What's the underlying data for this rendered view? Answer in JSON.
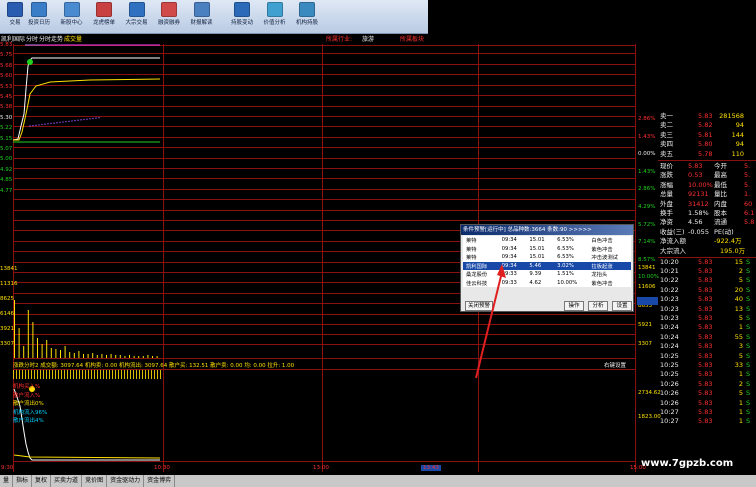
{
  "toolbar": [
    {
      "label": "交易",
      "color": "#2a5db0"
    },
    {
      "label": "投资日历",
      "color": "#3a7ec8"
    },
    {
      "label": "新股中心",
      "color": "#4a8ad0"
    },
    {
      "label": "龙虎榜单",
      "color": "#c84040"
    },
    {
      "label": "大宗交易",
      "color": "#3070c0"
    },
    {
      "label": "融资融券",
      "color": "#d04a4a"
    },
    {
      "label": "财报解读",
      "color": "#4a80c0"
    },
    {
      "label": "持股变动",
      "color": "#2a6ab8"
    },
    {
      "label": "价值分析",
      "color": "#40a0d0"
    },
    {
      "label": "机构持股",
      "color": "#3a8ac0"
    }
  ],
  "tabs": {
    "t1": "分时",
    "t2": "分时走势",
    "t3": "成交量"
  },
  "stock": {
    "name": "凯利国际"
  },
  "info": {
    "industry_label": "所属行业:",
    "industry_value": "旅游",
    "concept_label": "所属板块"
  },
  "price_axis": [
    "5.83",
    "5.75",
    "5.68",
    "5.60",
    "5.53",
    "5.45",
    "5.38",
    "5.30",
    "5.22",
    "5.15",
    "5.07",
    "5.00",
    "4.92",
    "4.85",
    "4.77"
  ],
  "pct_axis": [
    "2.86%",
    "1.43%",
    "0.00%",
    "1.43%",
    "2.86%",
    "4.29%",
    "5.72%",
    "7.14%",
    "8.57%",
    "10.00%"
  ],
  "vol_axis_left": [
    "13841",
    "11316",
    "8625",
    "6146",
    "3921",
    "3307"
  ],
  "vol_axis_right": [
    "13841",
    "11606",
    "8653",
    "5921",
    "3307"
  ],
  "fund_axis": [
    "2734.62",
    "1823.00"
  ],
  "volume_stats": "涨跌分时2  成交额: 3097.64  机构卖: 0.00  机构流出: 3097.64  散户买: 132.51  散户卖: 0.00  均: 0.00  拉升: 1.00",
  "setting_label": "右键设置",
  "ind_legend": [
    "机构买入%",
    "散户流入%",
    "散户流出0%",
    "机构流入96%",
    "散户流出4%"
  ],
  "time_axis": [
    "9:30",
    "10:30",
    "13:00",
    "13:43",
    "15:00"
  ],
  "quote_book": [
    {
      "label": "卖一",
      "price": "5.83",
      "vol": "281568"
    },
    {
      "label": "卖二",
      "price": "5.82",
      "vol": "94"
    },
    {
      "label": "卖三",
      "price": "5.81",
      "vol": "144"
    },
    {
      "label": "卖四",
      "price": "5.80",
      "vol": "94"
    },
    {
      "label": "卖五",
      "price": "5.78",
      "vol": "110"
    }
  ],
  "quote_stats": [
    {
      "l1": "现价",
      "v1": "5.83",
      "l2": "今开",
      "v2": "5."
    },
    {
      "l1": "涨跌",
      "v1": "0.53",
      "l2": "最高",
      "v2": "5."
    },
    {
      "l1": "涨幅",
      "v1": "10.00%",
      "l2": "最低",
      "v2": "5."
    },
    {
      "l1": "总量",
      "v1": "92131",
      "l2": "量比",
      "v2": "1."
    },
    {
      "l1": "外盘",
      "v1": "31412",
      "l2": "内盘",
      "v2": "60"
    },
    {
      "l1": "换手",
      "v1": "1.58%",
      "l2": "股本",
      "v2": "6.1"
    },
    {
      "l1": "净资",
      "v1": "4.56",
      "l2": "流通",
      "v2": "5.8"
    },
    {
      "l1": "收益(三)",
      "v1": "-0.055",
      "l2": "PE(动)",
      "v2": ""
    }
  ],
  "net_flow": {
    "label1": "净流入额",
    "value1": "-922.4万",
    "label2": "大宗流入",
    "value2": "195.0万"
  },
  "ticks": [
    {
      "time": "10:20",
      "price": "5.83",
      "vol": "15",
      "side": "S"
    },
    {
      "time": "10:21",
      "price": "5.83",
      "vol": "2",
      "side": "S"
    },
    {
      "time": "10:22",
      "price": "5.83",
      "vol": "5",
      "side": "S"
    },
    {
      "time": "10:22",
      "price": "5.83",
      "vol": "20",
      "side": "S"
    },
    {
      "time": "10:23",
      "price": "5.83",
      "vol": "40",
      "side": "S"
    },
    {
      "time": "10:23",
      "price": "5.83",
      "vol": "13",
      "side": "S"
    },
    {
      "time": "10:23",
      "price": "5.83",
      "vol": "5",
      "side": "S"
    },
    {
      "time": "10:24",
      "price": "5.83",
      "vol": "1",
      "side": "S"
    },
    {
      "time": "10:24",
      "price": "5.83",
      "vol": "55",
      "side": "S"
    },
    {
      "time": "10:24",
      "price": "5.83",
      "vol": "3",
      "side": "S"
    },
    {
      "time": "10:25",
      "price": "5.83",
      "vol": "5",
      "side": "S"
    },
    {
      "time": "10:25",
      "price": "5.83",
      "vol": "33",
      "side": "S"
    },
    {
      "time": "10:25",
      "price": "5.83",
      "vol": "1",
      "side": "S"
    },
    {
      "time": "10:26",
      "price": "5.83",
      "vol": "2",
      "side": "S"
    },
    {
      "time": "10:26",
      "price": "5.83",
      "vol": "5",
      "side": "S"
    },
    {
      "time": "10:26",
      "price": "5.83",
      "vol": "1",
      "side": "S"
    },
    {
      "time": "10:27",
      "price": "5.83",
      "vol": "1",
      "side": "S"
    },
    {
      "time": "10:27",
      "price": "5.83",
      "vol": "1",
      "side": "S"
    }
  ],
  "popup": {
    "title": "条件预警[运行中]  总品种数:3664  条数:90  >>>>>",
    "rows": [
      {
        "name": "莱特",
        "time": "09:34",
        "price": "15.01",
        "pct": "6.53%",
        "note": "白色冲击"
      },
      {
        "name": "莱特",
        "time": "09:34",
        "price": "15.01",
        "pct": "6.53%",
        "note": "紫色冲击"
      },
      {
        "name": "莱特",
        "time": "09:34",
        "price": "15.01",
        "pct": "6.53%",
        "note": "冲击波测试"
      },
      {
        "name": "凯利国际",
        "time": "09:34",
        "price": "5.46",
        "pct": "3.02%",
        "note": "拉板起涨"
      },
      {
        "name": "桑龙股份",
        "time": "09:33",
        "price": "9.39",
        "pct": "1.51%",
        "note": "龙抬头"
      },
      {
        "name": "佳云科技",
        "time": "09:33",
        "price": "4.62",
        "pct": "10.00%",
        "note": "紫色冲击"
      }
    ],
    "close_label": "关闭预警",
    "op_label": "操作",
    "analyze_label": "分析",
    "settings_label": "设置"
  },
  "watermark": "www.7gpzb.com",
  "bottom_tabs": [
    "量",
    "指标",
    "复权",
    "买卖力道",
    "竞价图",
    "资金驱动力",
    "资金博弈"
  ]
}
